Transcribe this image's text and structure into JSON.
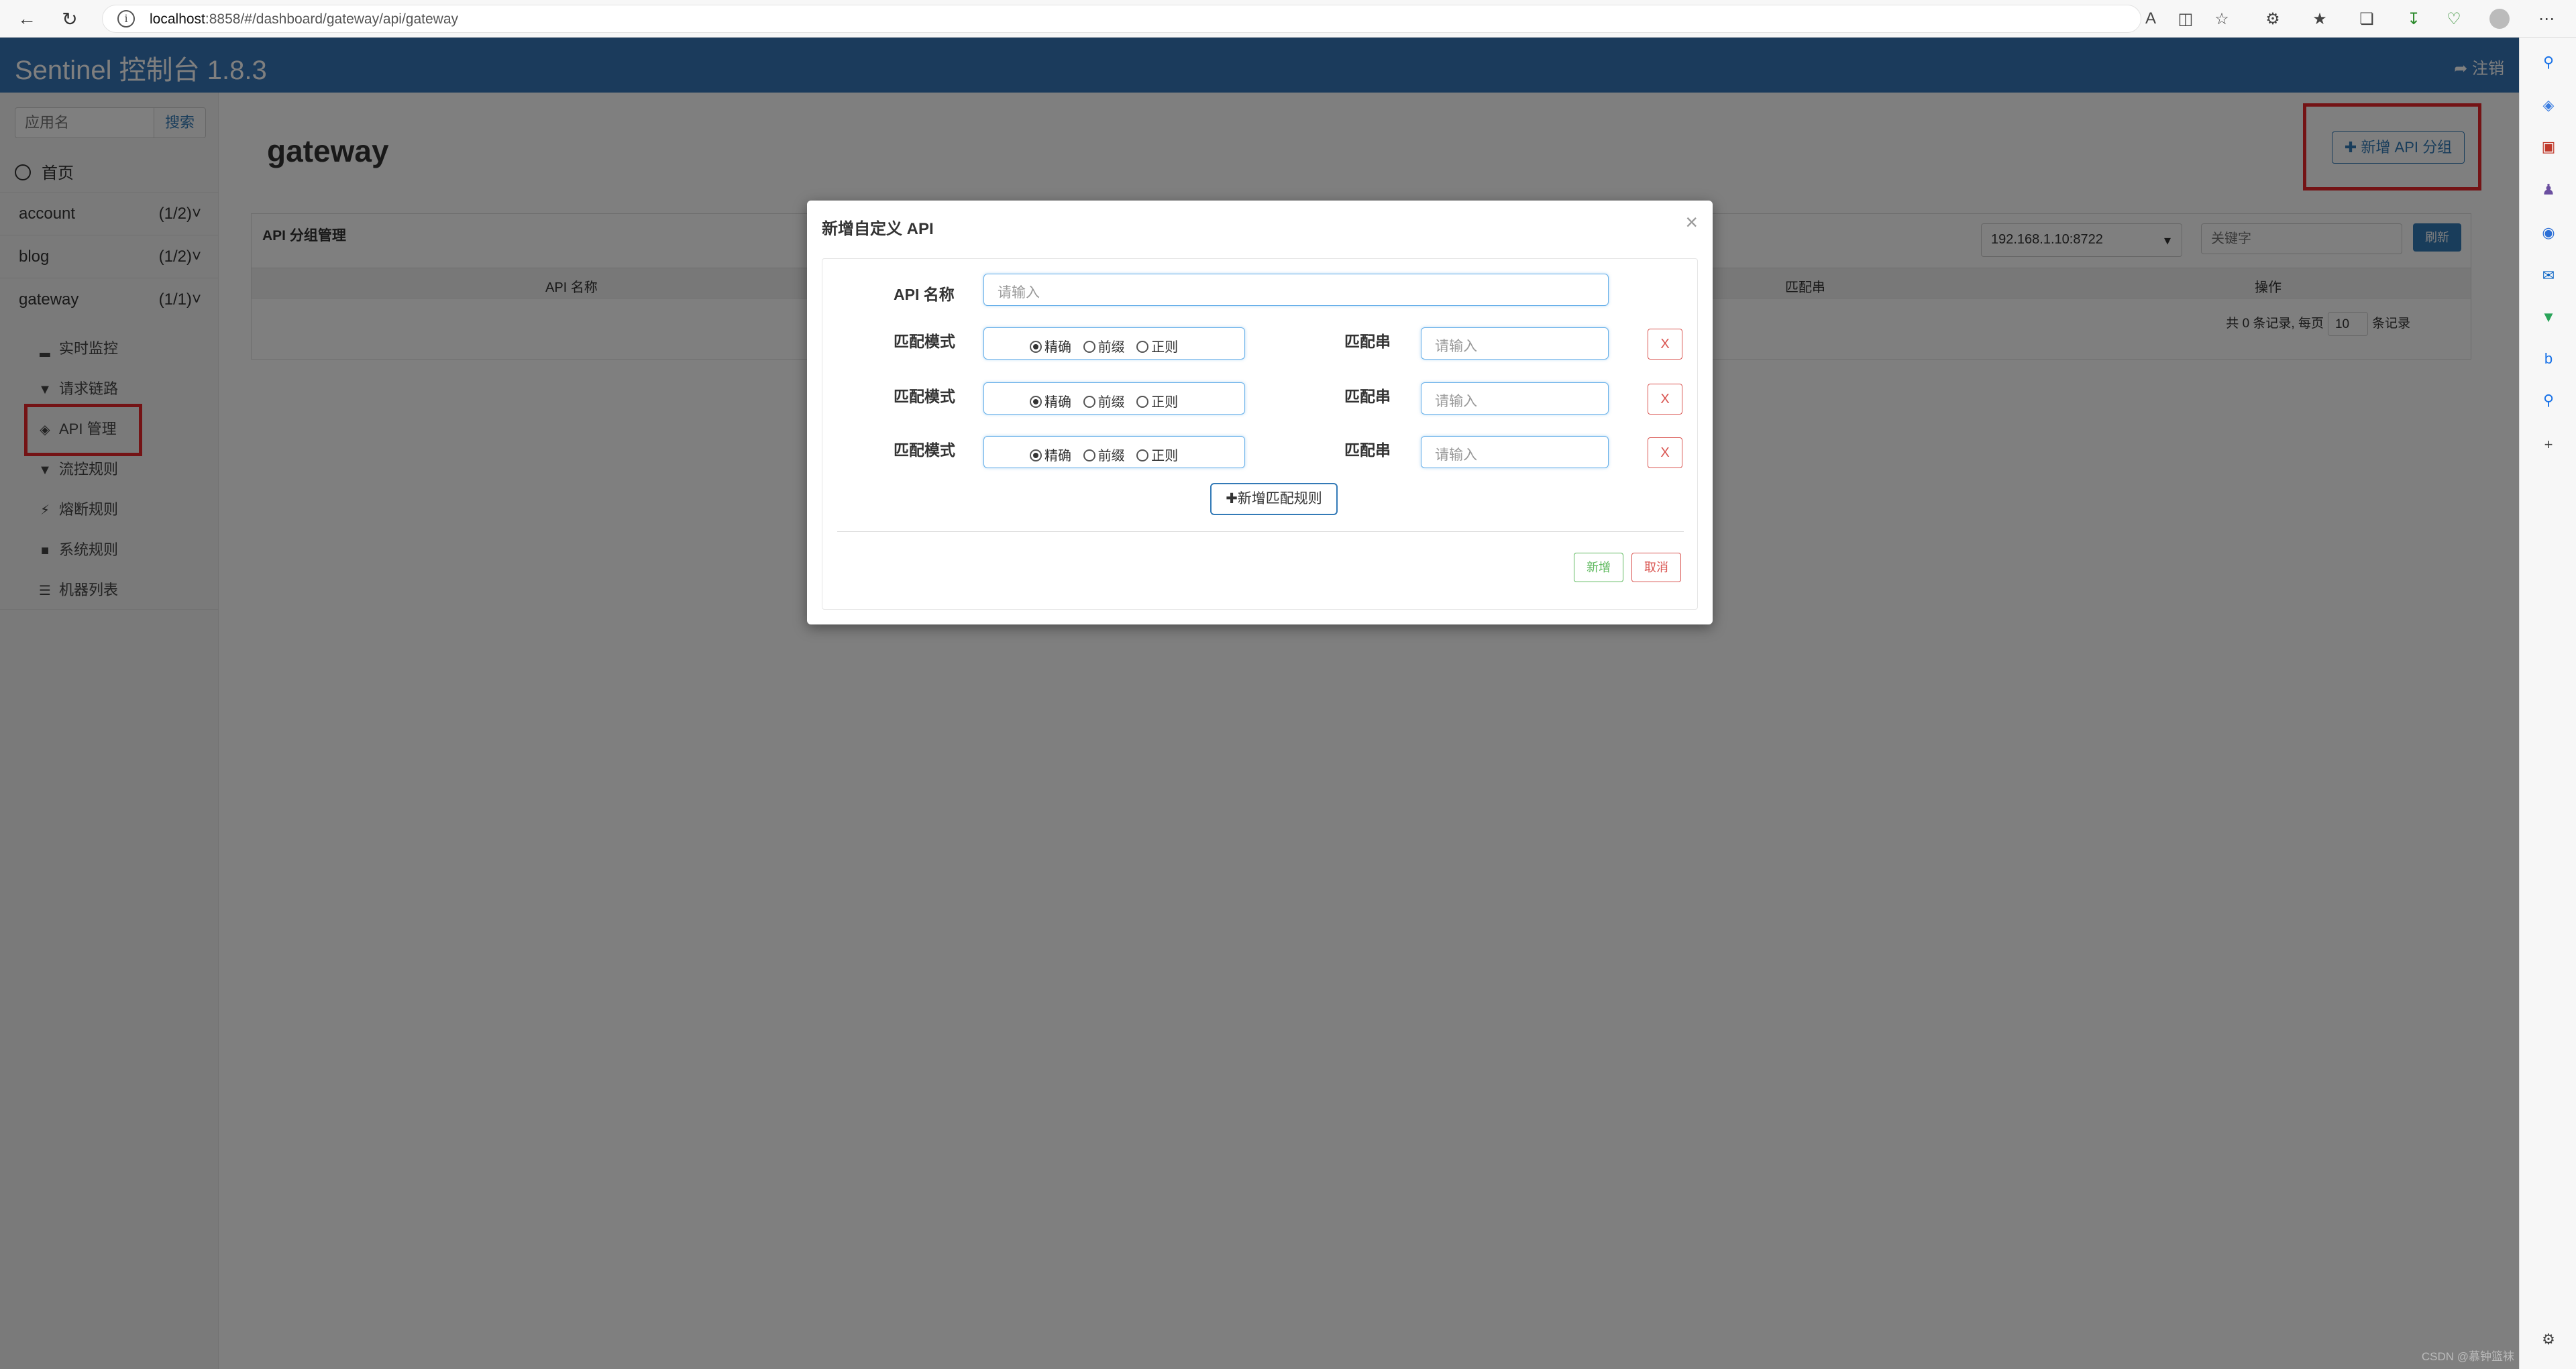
{
  "browser": {
    "url_host": "localhost",
    "url_rest": ":8858/#/dashboard/gateway/api/gateway"
  },
  "header": {
    "brand": "Sentinel 控制台 1.8.3",
    "logout": "注销"
  },
  "sidebar": {
    "search_placeholder": "应用名",
    "search_button": "搜索",
    "home": "首页",
    "apps": [
      {
        "name": "account",
        "count": "(1/2)"
      },
      {
        "name": "blog",
        "count": "(1/2)"
      },
      {
        "name": "gateway",
        "count": "(1/1)"
      }
    ],
    "menu": [
      {
        "label": "实时监控",
        "icon": "bar-chart-icon"
      },
      {
        "label": "请求链路",
        "icon": "filter-icon"
      },
      {
        "label": "API 管理",
        "icon": "tags-icon"
      },
      {
        "label": "流控规则",
        "icon": "filter-icon"
      },
      {
        "label": "熔断规则",
        "icon": "bolt-icon"
      },
      {
        "label": "系统规则",
        "icon": "lock-icon"
      },
      {
        "label": "机器列表",
        "icon": "list-icon"
      }
    ]
  },
  "main": {
    "title": "gateway",
    "add_group_button": "新增 API 分组",
    "panel_title": "API 分组管理",
    "machine": "192.168.1.10:8722",
    "keyword_placeholder": "关键字",
    "refresh_button": "刷新",
    "columns": [
      "API 名称",
      "匹配串",
      "操作"
    ],
    "pagination": {
      "prefix": "共 0 条记录, 每页",
      "page_size": "10",
      "suffix": "条记录"
    }
  },
  "modal": {
    "title": "新增自定义 API",
    "api_name_label": "API 名称",
    "api_name_placeholder": "请输入",
    "match_mode_label": "匹配模式",
    "match_string_label": "匹配串",
    "match_string_placeholder": "请输入",
    "radio_options": [
      "精确",
      "前缀",
      "正则"
    ],
    "delete_label": "X",
    "add_rule_button": "新增匹配规则",
    "submit_button": "新增",
    "cancel_button": "取消"
  },
  "watermark": "CSDN @慕钟篮袜",
  "colors": {
    "header_blue": "#3776b8",
    "highlight_red": "#e8262b",
    "primary": "#337ab7",
    "danger": "#d9534f",
    "success": "#5cb85c"
  }
}
